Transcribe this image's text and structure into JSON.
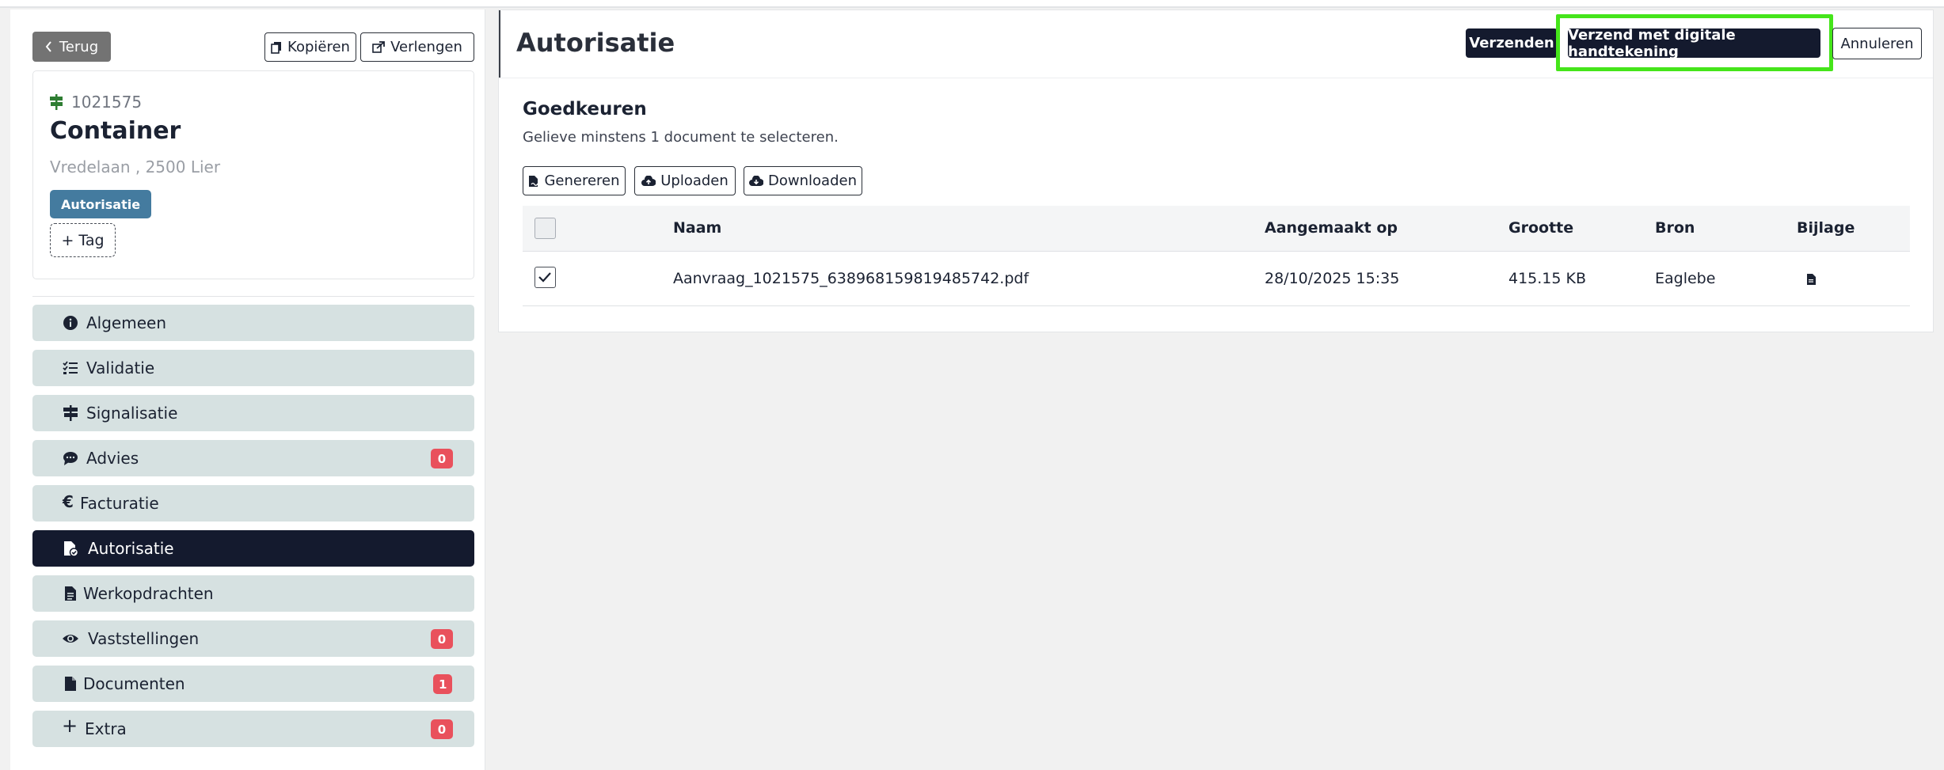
{
  "sidebar": {
    "back_label": "Terug",
    "copy_label": "Kopiëren",
    "extend_label": "Verlengen",
    "dossier_number": "1021575",
    "title": "Container",
    "address": "Vredelaan , 2500 Lier",
    "tag": "Autorisatie",
    "add_tag_label": "+ Tag",
    "items": [
      {
        "label": "Algemeen",
        "icon": "info-circle-icon"
      },
      {
        "label": "Validatie",
        "icon": "checklist-icon"
      },
      {
        "label": "Signalisatie",
        "icon": "signpost-icon"
      },
      {
        "label": "Advies",
        "icon": "comment-icon",
        "badge": "0"
      },
      {
        "label": "Facturatie",
        "icon": "euro-icon"
      },
      {
        "label": "Autorisatie",
        "icon": "file-check-icon",
        "active": true
      },
      {
        "label": "Werkopdrachten",
        "icon": "file-text-icon"
      },
      {
        "label": "Vaststellingen",
        "icon": "eye-icon",
        "badge": "0"
      },
      {
        "label": "Documenten",
        "icon": "file-icon",
        "badge": "1"
      },
      {
        "label": "Extra",
        "icon": "plus-icon",
        "badge": "0"
      }
    ]
  },
  "main": {
    "title": "Autorisatie",
    "send_label": "Verzenden",
    "sign_label": "Verzend met digitale handtekening",
    "cancel_label": "Annuleren",
    "section_title": "Goedkeuren",
    "hint": "Gelieve minstens 1 document te selecteren.",
    "generate_label": "Genereren",
    "upload_label": "Uploaden",
    "download_label": "Downloaden",
    "table": {
      "columns": [
        "Naam",
        "Aangemaakt op",
        "Grootte",
        "Bron",
        "Bijlage"
      ],
      "rows": [
        {
          "checked": true,
          "name": "Aanvraag_1021575_638968159819485742.pdf",
          "created": "28/10/2025 15:35",
          "size": "415.15 KB",
          "source": "Eaglebe"
        }
      ]
    }
  },
  "colors": {
    "nav_bg": "#d6e1e1",
    "nav_active": "#141a2e",
    "badge": "#e9515c",
    "tag": "#447b9f",
    "highlight": "#45e51a"
  }
}
